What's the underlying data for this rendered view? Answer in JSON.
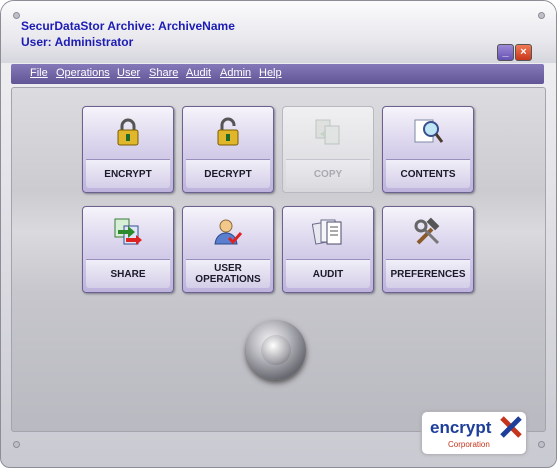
{
  "window": {
    "title_line1": "SecurDataStor Archive: ArchiveName",
    "title_line2": "User: Administrator",
    "minimize_symbol": "_",
    "close_symbol": "×"
  },
  "menu": [
    "File",
    "Operations",
    "User",
    "Share",
    "Audit",
    "Admin",
    "Help"
  ],
  "buttons": {
    "encrypt": "ENCRYPT",
    "decrypt": "DECRYPT",
    "copy": "COPY",
    "contents": "CONTENTS",
    "share": "SHARE",
    "user_operations": "USER OPERATIONS",
    "audit": "AUDIT",
    "preferences": "PREFERENCES"
  },
  "logo": {
    "brand": "encrypt",
    "sub": "Corporation"
  },
  "colors": {
    "title_text": "#1c1cb4",
    "menubar": "#6f64a6",
    "accent_red": "#c7361a"
  }
}
